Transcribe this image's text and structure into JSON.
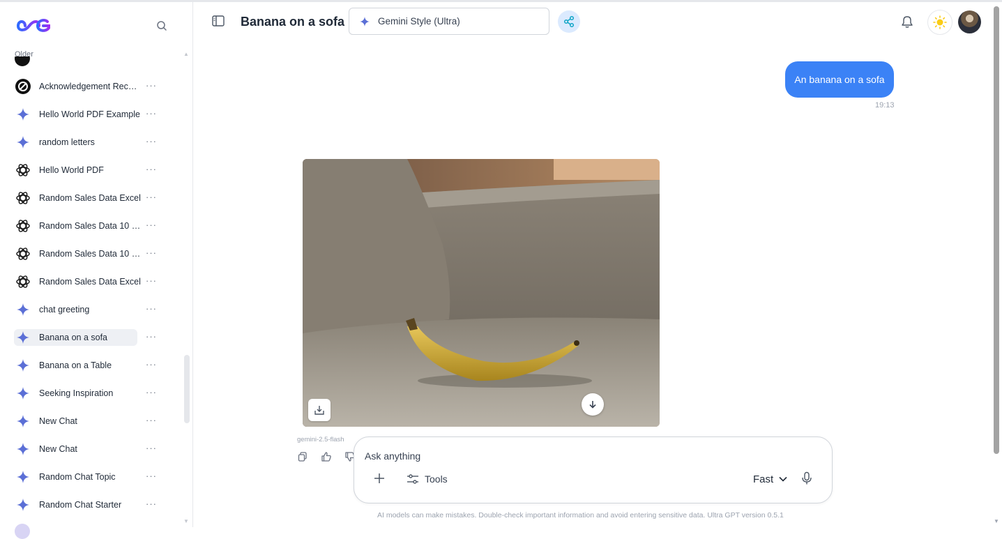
{
  "sidebar": {
    "section_label": "Older",
    "items": [
      {
        "label": "Acknowledgement Recei…",
        "icon": "ultra-logo-icon"
      },
      {
        "label": "Hello World PDF Example",
        "icon": "gemini-sparkle-icon"
      },
      {
        "label": "random letters",
        "icon": "gemini-sparkle-icon"
      },
      {
        "label": "Hello World PDF",
        "icon": "openai-logo-icon"
      },
      {
        "label": "Random Sales Data Excel",
        "icon": "openai-logo-icon"
      },
      {
        "label": "Random Sales Data 10 R…",
        "icon": "openai-logo-icon"
      },
      {
        "label": "Random Sales Data 10 R…",
        "icon": "openai-logo-icon"
      },
      {
        "label": "Random Sales Data Excel",
        "icon": "openai-logo-icon"
      },
      {
        "label": "chat greeting",
        "icon": "gemini-sparkle-icon"
      },
      {
        "label": "Banana on a sofa",
        "icon": "gemini-sparkle-icon",
        "active": true
      },
      {
        "label": "Banana on a Table",
        "icon": "gemini-sparkle-icon"
      },
      {
        "label": "Seeking Inspiration",
        "icon": "gemini-sparkle-icon"
      },
      {
        "label": "New Chat",
        "icon": "gemini-sparkle-icon"
      },
      {
        "label": "New Chat",
        "icon": "gemini-sparkle-icon"
      },
      {
        "label": "Random Chat Topic",
        "icon": "gemini-sparkle-icon"
      },
      {
        "label": "Random Chat Starter",
        "icon": "gemini-sparkle-icon"
      }
    ],
    "more_glyph": "···"
  },
  "header": {
    "title": "Banana on a sofa",
    "model": "Gemini Style (Ultra)"
  },
  "conversation": {
    "user_message": "An banana on a sofa",
    "user_time": "19:13",
    "assistant_model": "gemini-2.5-flash"
  },
  "composer": {
    "placeholder": "Ask anything",
    "tools_label": "Tools",
    "speed_label": "Fast"
  },
  "footer": {
    "disclaimer": "AI models can make mistakes. Double-check important information and avoid entering sensitive data. Ultra GPT version 0.5.1"
  },
  "colors": {
    "accent": "#3b82f6",
    "sparkle": "#5b6fd6",
    "active_item_bg": "#eef0f4"
  }
}
